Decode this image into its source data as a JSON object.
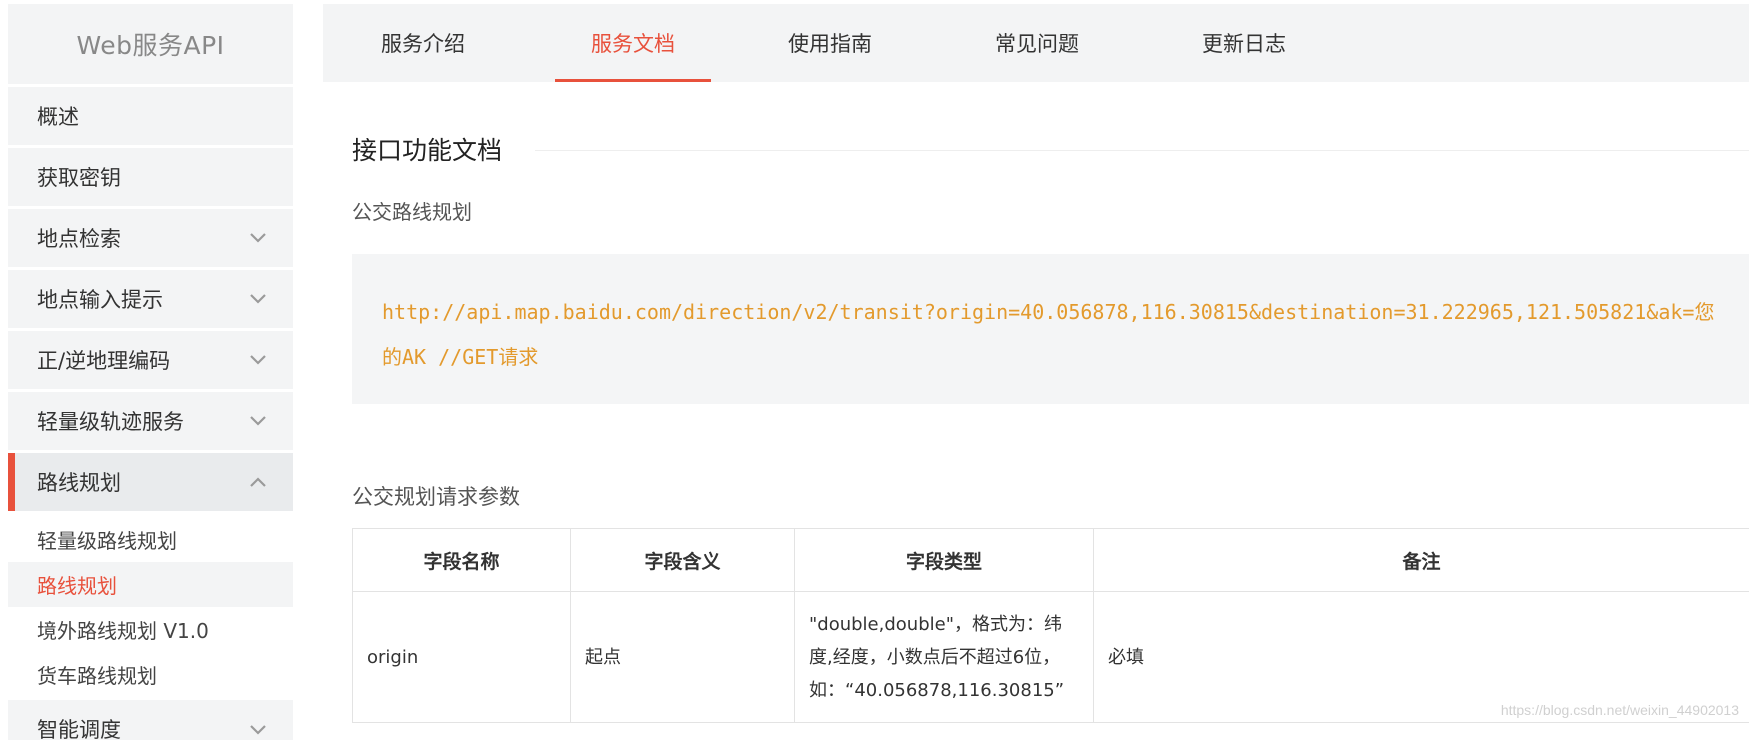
{
  "sidebar": {
    "title": "Web服务API",
    "items": [
      {
        "label": "概述",
        "has_chevron": false
      },
      {
        "label": "获取密钥",
        "has_chevron": false
      },
      {
        "label": "地点检索",
        "has_chevron": true
      },
      {
        "label": "地点输入提示",
        "has_chevron": true
      },
      {
        "label": "正/逆地理编码",
        "has_chevron": true
      },
      {
        "label": "轻量级轨迹服务",
        "has_chevron": true
      },
      {
        "label": "路线规划",
        "has_chevron": true,
        "expanded": true,
        "active": true
      }
    ],
    "sub_items": [
      {
        "label": "轻量级路线规划",
        "active": false
      },
      {
        "label": "路线规划",
        "active": true
      },
      {
        "label": "境外路线规划 V1.0",
        "active": false
      },
      {
        "label": "货车路线规划",
        "active": false
      }
    ],
    "partial_item": {
      "label": "智能调度",
      "has_chevron": true
    }
  },
  "tabs": [
    {
      "label": "服务介绍",
      "active": false
    },
    {
      "label": "服务文档",
      "active": true
    },
    {
      "label": "使用指南",
      "active": false
    },
    {
      "label": "常见问题",
      "active": false
    },
    {
      "label": "更新日志",
      "active": false
    }
  ],
  "content": {
    "section_title": "接口功能文档",
    "subsection_title": "公交路线规划",
    "request_url": "http://api.map.baidu.com/direction/v2/transit?origin=40.056878,116.30815&destination=31.222965,121.505821&ak=您的AK  //GET请求",
    "params_title": "公交规划请求参数",
    "table": {
      "headers": [
        "字段名称",
        "字段含义",
        "字段类型",
        "备注"
      ],
      "rows": [
        [
          "origin",
          "起点",
          "\"double,double\"，格式为：纬度,经度，小数点后不超过6位，如：“40.056878,116.30815”",
          "必填"
        ]
      ]
    }
  },
  "watermark": "https://blog.csdn.net/weixin_44902013",
  "colors": {
    "accent": "#e8513c",
    "code": "#e39a2d",
    "panel_bg": "#f3f4f5"
  },
  "icons": {
    "chevron_down": "chevron-down-icon",
    "chevron_up": "chevron-up-icon"
  }
}
